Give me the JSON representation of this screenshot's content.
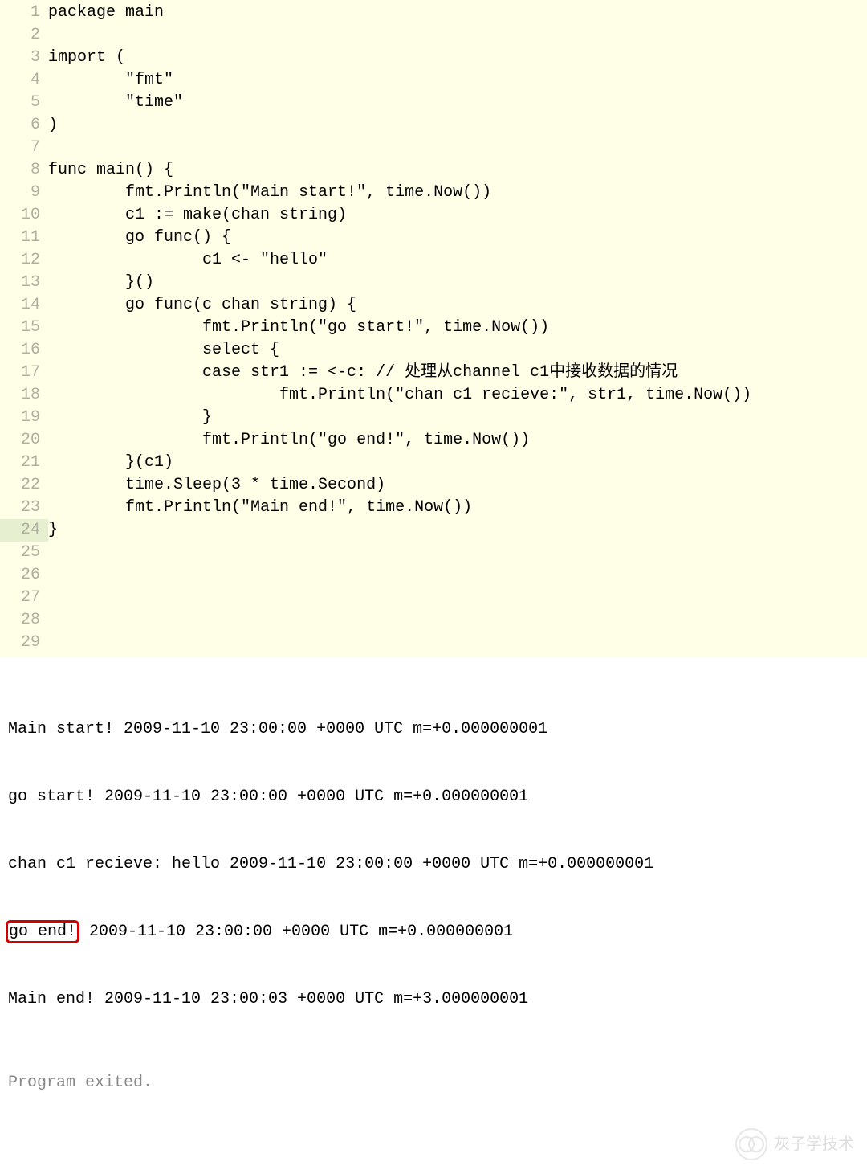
{
  "code": {
    "lines": [
      {
        "n": 1,
        "text": "package main"
      },
      {
        "n": 2,
        "text": ""
      },
      {
        "n": 3,
        "text": "import ("
      },
      {
        "n": 4,
        "text": "        \"fmt\""
      },
      {
        "n": 5,
        "text": "        \"time\""
      },
      {
        "n": 6,
        "text": ")"
      },
      {
        "n": 7,
        "text": ""
      },
      {
        "n": 8,
        "text": "func main() {"
      },
      {
        "n": 9,
        "text": "        fmt.Println(\"Main start!\", time.Now())"
      },
      {
        "n": 10,
        "text": "        c1 := make(chan string)"
      },
      {
        "n": 11,
        "text": "        go func() {"
      },
      {
        "n": 12,
        "text": "                c1 <- \"hello\""
      },
      {
        "n": 13,
        "text": "        }()"
      },
      {
        "n": 14,
        "text": "        go func(c chan string) {"
      },
      {
        "n": 15,
        "text": "                fmt.Println(\"go start!\", time.Now())"
      },
      {
        "n": 16,
        "text": "                select {"
      },
      {
        "n": 17,
        "text": "                case str1 := <-c: // 处理从channel c1中接收数据的情况"
      },
      {
        "n": 18,
        "text": "                        fmt.Println(\"chan c1 recieve:\", str1, time.Now())"
      },
      {
        "n": 19,
        "text": "                }"
      },
      {
        "n": 20,
        "text": "                fmt.Println(\"go end!\", time.Now())"
      },
      {
        "n": 21,
        "text": "        }(c1)"
      },
      {
        "n": 22,
        "text": "        time.Sleep(3 * time.Second)"
      },
      {
        "n": 23,
        "text": "        fmt.Println(\"Main end!\", time.Now())"
      },
      {
        "n": 24,
        "text": "}"
      },
      {
        "n": 25,
        "text": ""
      },
      {
        "n": 26,
        "text": ""
      },
      {
        "n": 27,
        "text": ""
      },
      {
        "n": 28,
        "text": ""
      },
      {
        "n": 29,
        "text": ""
      }
    ]
  },
  "output": {
    "lines": [
      "Main start! 2009-11-10 23:00:00 +0000 UTC m=+0.000000001",
      "go start! 2009-11-10 23:00:00 +0000 UTC m=+0.000000001",
      "chan c1 recieve: hello 2009-11-10 23:00:00 +0000 UTC m=+0.000000001"
    ],
    "highlighted": {
      "boxed": "go end!",
      "rest": " 2009-11-10 23:00:00 +0000 UTC m=+0.000000001"
    },
    "after": [
      "Main end! 2009-11-10 23:00:03 +0000 UTC m=+3.000000001"
    ],
    "exited": "Program exited."
  },
  "watermark": "灰子学技术"
}
